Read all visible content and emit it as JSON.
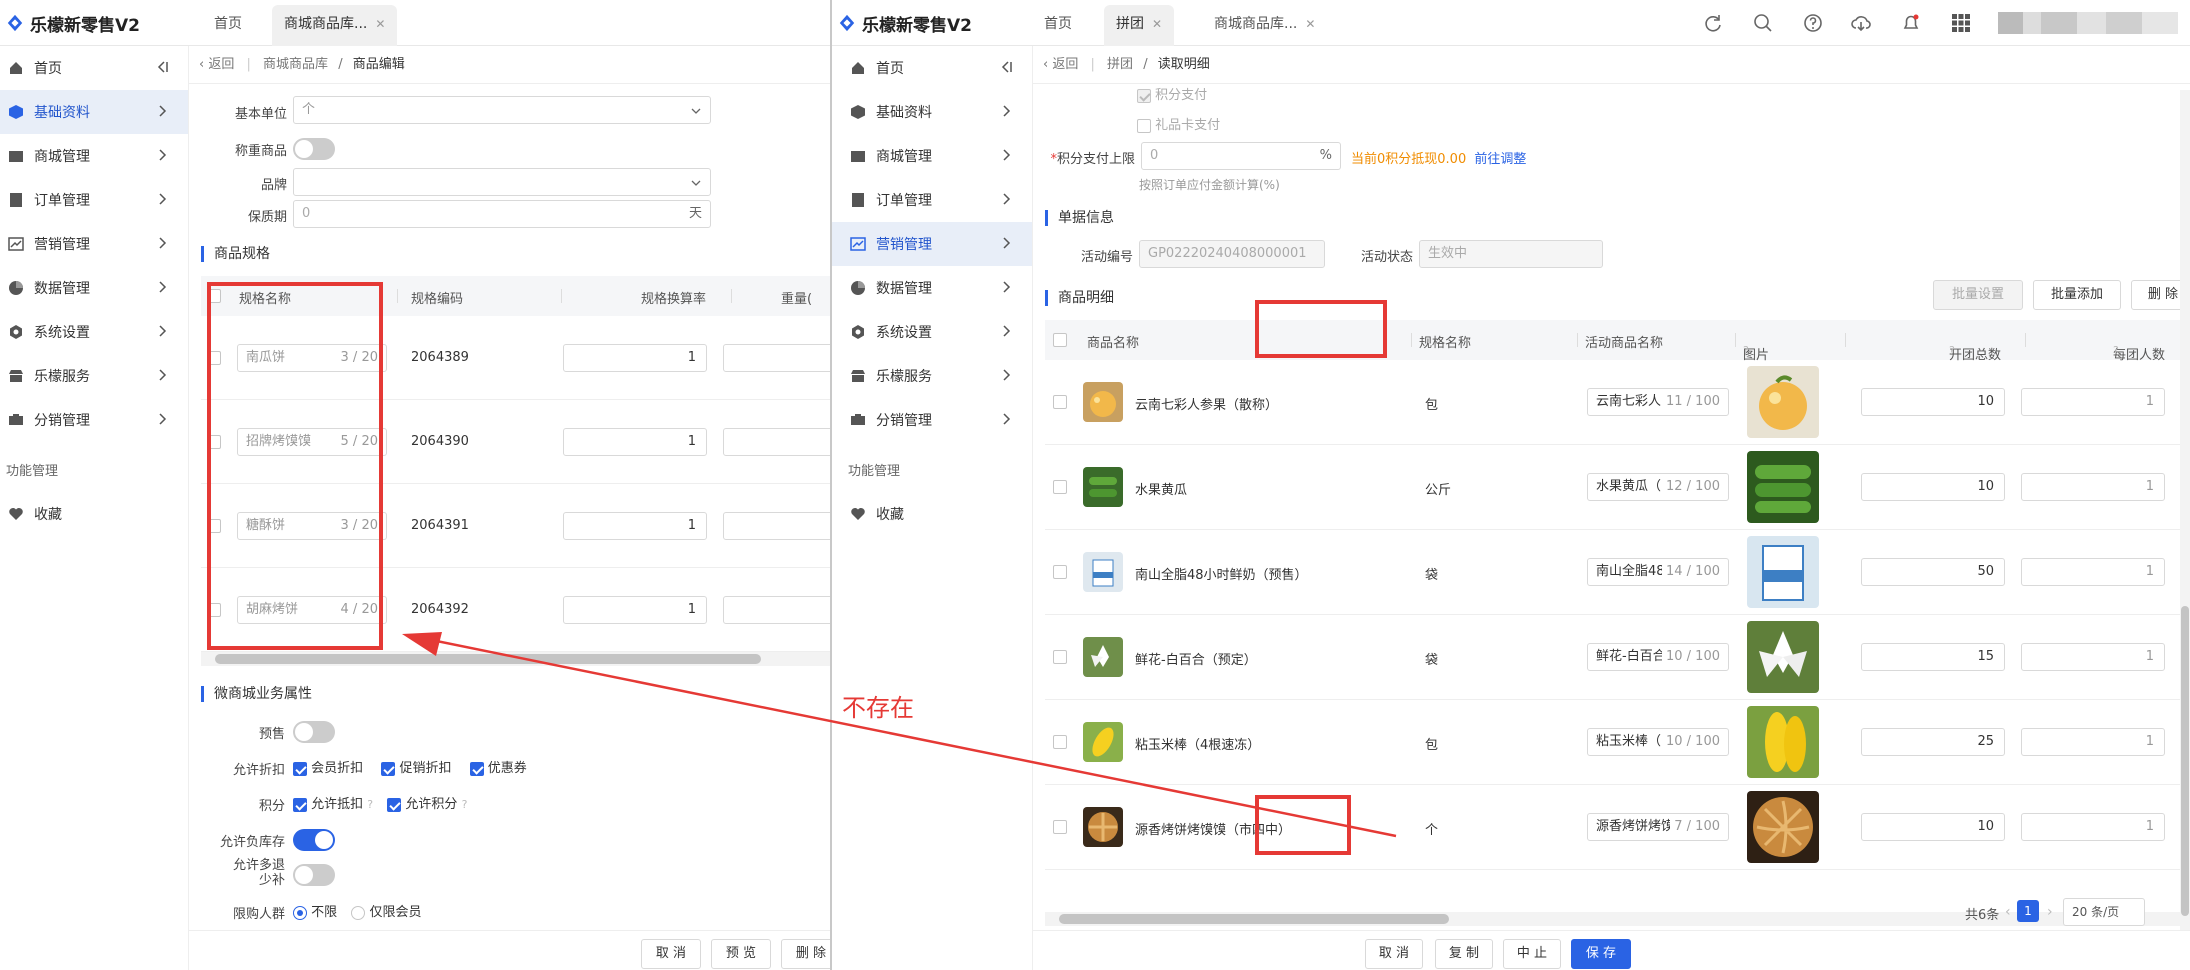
{
  "left": {
    "app_title": "乐檬新零售V2",
    "tabs": [
      {
        "label": "首页"
      },
      {
        "label": "商城商品库..."
      }
    ],
    "sidebar": {
      "items": [
        {
          "label": "首页"
        },
        {
          "label": "基础资料"
        },
        {
          "label": "商城管理"
        },
        {
          "label": "订单管理"
        },
        {
          "label": "营销管理"
        },
        {
          "label": "数据管理"
        },
        {
          "label": "系统设置"
        },
        {
          "label": "乐檬服务"
        },
        {
          "label": "分销管理"
        }
      ],
      "section_label": "功能管理",
      "favorite_label": "收藏"
    },
    "breadcrumb": {
      "back": "返回",
      "parent": "商城商品库",
      "current": "商品编辑"
    },
    "form": {
      "unit_label": "基本单位",
      "unit_value": "个",
      "weigh_label": "称重商品",
      "brand_label": "品牌",
      "shelf_label": "保质期",
      "shelf_value": "0",
      "shelf_suffix": "天"
    },
    "spec_section": "商品规格",
    "spec_table": {
      "headers": [
        "规格名称",
        "规格编码",
        "规格换算率",
        "重量("
      ],
      "rows": [
        {
          "name": "南瓜饼",
          "count": "3 / 20",
          "code": "2064389",
          "rate": "1"
        },
        {
          "name": "招牌烤馍馍",
          "count": "5 / 20",
          "code": "2064390",
          "rate": "1"
        },
        {
          "name": "糖酥饼",
          "count": "3 / 20",
          "code": "2064391",
          "rate": "1"
        },
        {
          "name": "胡麻烤饼",
          "count": "4 / 20",
          "code": "2064392",
          "rate": "1"
        }
      ]
    },
    "biz_section": "微商城业务属性",
    "biz": {
      "presale_label": "预售",
      "discount_label": "允许折扣",
      "discount_opts": [
        "会员折扣",
        "促销折扣",
        "优惠券"
      ],
      "points_label": "积分",
      "points_opts": [
        "允许抵扣",
        "允许积分"
      ],
      "negative_label": "允许负库存",
      "refund_label_1": "允许多退",
      "refund_label_2": "少补",
      "limit_label": "限购人群",
      "limit_opts": [
        "不限",
        "仅限会员"
      ]
    },
    "footer": {
      "cancel": "取 消",
      "preview": "预 览",
      "delete": "删 除"
    }
  },
  "right": {
    "app_title": "乐檬新零售V2",
    "tabs": [
      {
        "label": "首页"
      },
      {
        "label": "拼团"
      },
      {
        "label": "商城商品库..."
      }
    ],
    "sidebar": {
      "items": [
        {
          "label": "首页"
        },
        {
          "label": "基础资料"
        },
        {
          "label": "商城管理"
        },
        {
          "label": "订单管理"
        },
        {
          "label": "营销管理"
        },
        {
          "label": "数据管理"
        },
        {
          "label": "系统设置"
        },
        {
          "label": "乐檬服务"
        },
        {
          "label": "分销管理"
        }
      ],
      "section_label": "功能管理",
      "favorite_label": "收藏"
    },
    "breadcrumb": {
      "back": "返回",
      "parent": "拼团",
      "current": "读取明细"
    },
    "payment": {
      "points_pay": "积分支付",
      "gift_pay": "礼品卡支付",
      "limit_label": "积分支付上限",
      "limit_value": "0",
      "limit_suffix": "%",
      "current_note": "当前0积分抵现0.00",
      "adjust_link": "前往调整",
      "hint": "按照订单应付金额计算(%)"
    },
    "doc_section": "单据信息",
    "doc": {
      "id_label": "活动编号",
      "id_value": "GP02220240408000001",
      "status_label": "活动状态",
      "status_value": "生效中"
    },
    "detail_section": "商品明细",
    "toolbar": {
      "batch_set": "批量设置",
      "batch_add": "批量添加",
      "delete": "删 除"
    },
    "table": {
      "headers": [
        "商品名称",
        "规格名称",
        "活动商品名称",
        "图片",
        "开团总数",
        "每团人数"
      ],
      "rows": [
        {
          "name": "云南七彩人参果（散称）",
          "spec": "包",
          "act_name": "云南七彩人",
          "count": "11 / 100",
          "total": "10",
          "per": "1"
        },
        {
          "name": "水果黄瓜",
          "spec": "公斤",
          "act_name": "水果黄瓜（",
          "count": "12 / 100",
          "total": "10",
          "per": "1"
        },
        {
          "name": "南山全脂48小时鲜奶（预售）",
          "spec": "袋",
          "act_name": "南山全脂48",
          "count": "14 / 100",
          "total": "50",
          "per": "1"
        },
        {
          "name": "鲜花-白百合（预定）",
          "spec": "袋",
          "act_name": "鲜花-白百合",
          "count": "10 / 100",
          "total": "15",
          "per": "1"
        },
        {
          "name": "粘玉米棒（4根速冻）",
          "spec": "包",
          "act_name": "粘玉米棒（",
          "count": "10 / 100",
          "total": "25",
          "per": "1"
        },
        {
          "name": "源香烤饼烤馍馍（市四中）",
          "spec": "个",
          "act_name": "源香烤饼烤馍",
          "count": "7 / 100",
          "total": "10",
          "per": "1"
        }
      ]
    },
    "pagination": {
      "total": "共6条",
      "page": "1",
      "size": "20 条/页"
    },
    "footer": {
      "cancel": "取 消",
      "copy": "复 制",
      "stop": "中 止",
      "save": "保 存"
    }
  },
  "annotation": {
    "text": "不存在"
  },
  "colors": {
    "accent": "#2a63e4",
    "annotation": "#e53935",
    "warning": "#f08c00"
  }
}
